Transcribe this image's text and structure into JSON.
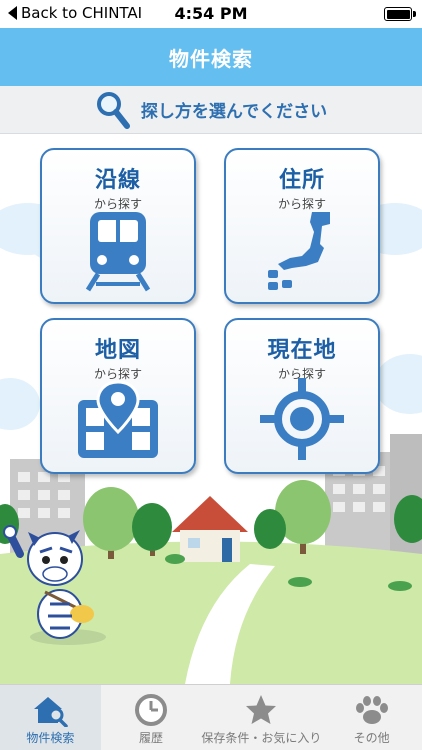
{
  "status_bar": {
    "back_label": "Back to CHINTAI",
    "time": "4:54 PM"
  },
  "nav": {
    "title": "物件検索"
  },
  "instruction": {
    "text": "探し方を選んでください",
    "icon": "search-icon"
  },
  "tiles": [
    {
      "title": "沿線",
      "sub": "から探す",
      "icon": "train-icon"
    },
    {
      "title": "住所",
      "sub": "から探す",
      "icon": "japan-map-icon"
    },
    {
      "title": "地図",
      "sub": "から探す",
      "icon": "map-pin-icon"
    },
    {
      "title": "現在地",
      "sub": "から探す",
      "icon": "crosshair-icon"
    }
  ],
  "tabs": [
    {
      "label": "物件検索",
      "icon": "house-search-icon",
      "active": true
    },
    {
      "label": "履歴",
      "icon": "clock-icon",
      "active": false
    },
    {
      "label": "保存条件・お気に入り",
      "icon": "star-icon",
      "active": false
    },
    {
      "label": "その他",
      "icon": "paw-icon",
      "active": false
    }
  ],
  "colors": {
    "nav_bg": "#64bff0",
    "accent": "#1d5fa5",
    "grass": "#cfe9a8"
  }
}
